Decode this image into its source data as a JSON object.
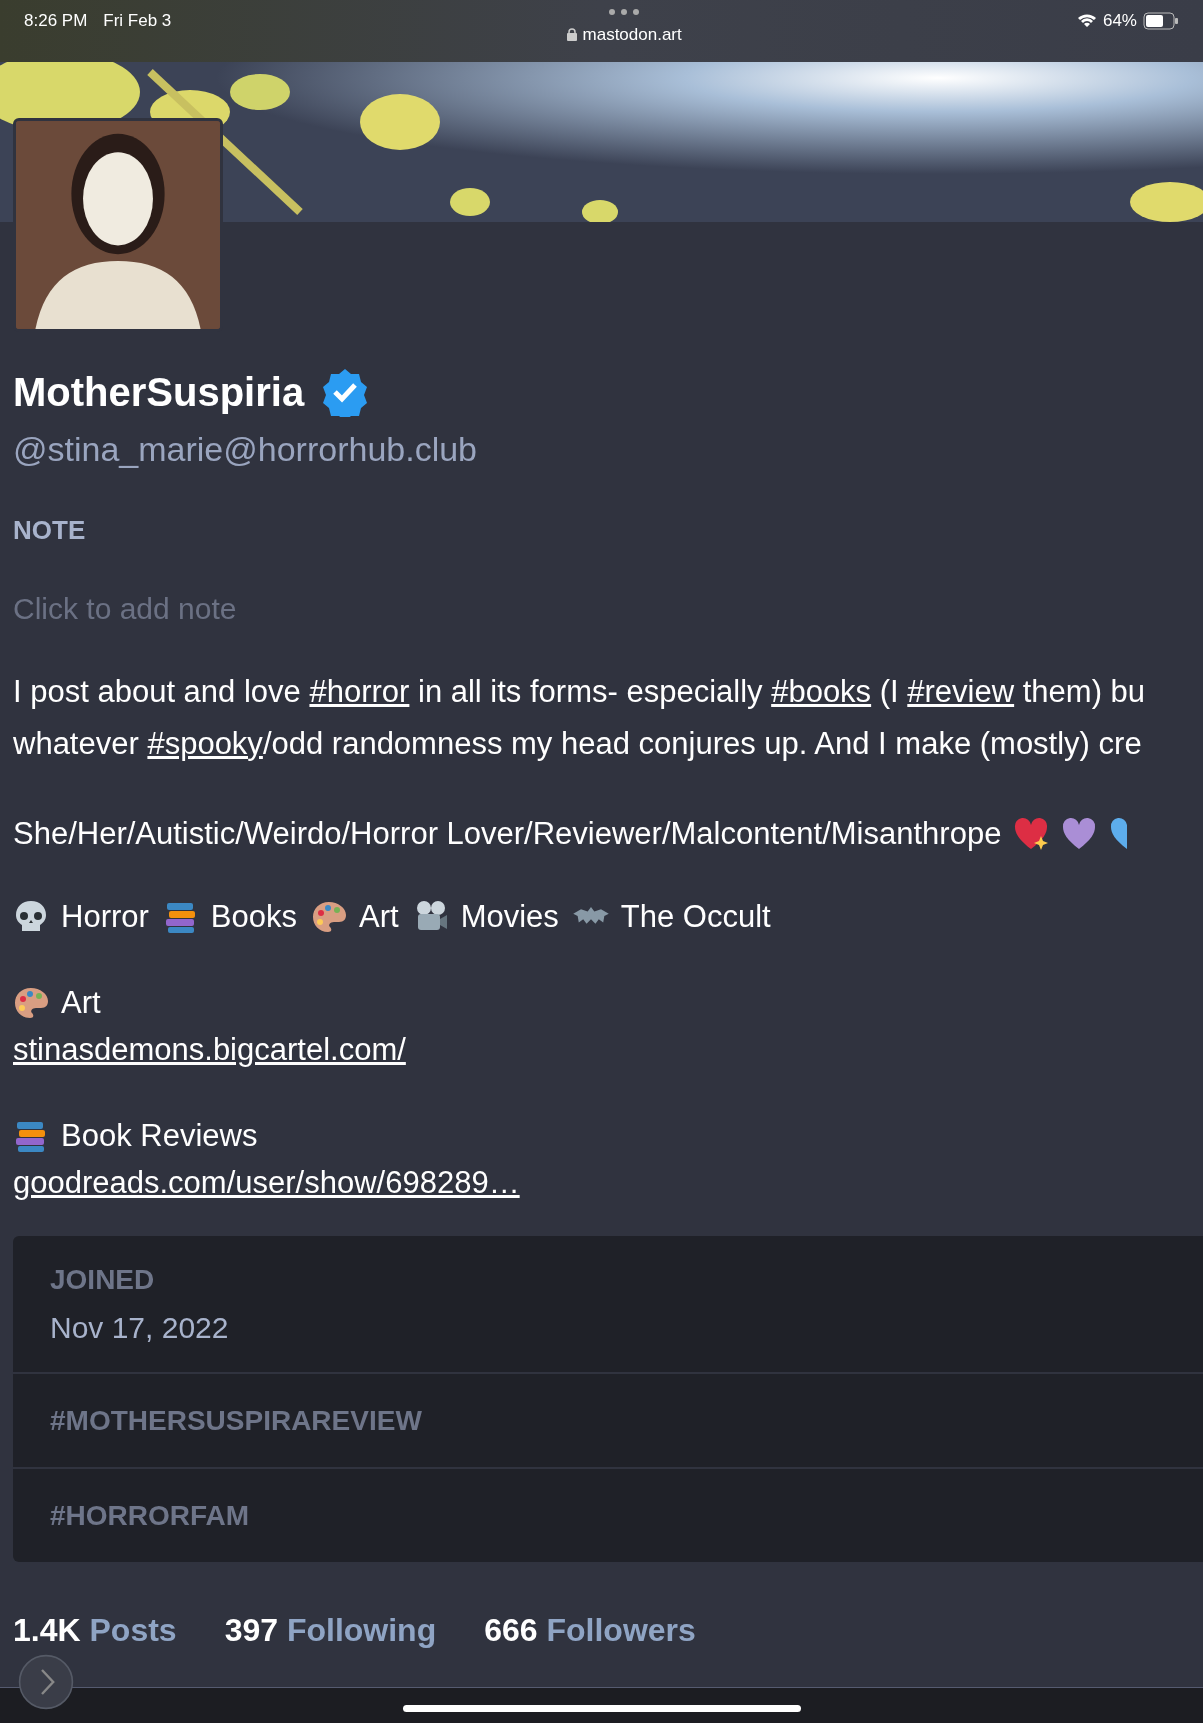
{
  "status_bar": {
    "time": "8:26 PM",
    "date": "Fri Feb 3",
    "url": "mastodon.art",
    "battery": "64%"
  },
  "profile": {
    "display_name": "MotherSuspiria",
    "verified": true,
    "handle": "@stina_marie@horrorhub.club"
  },
  "note": {
    "label": "NOTE",
    "placeholder": "Click to add note"
  },
  "bio_lines": [
    [
      {
        "kind": "text",
        "text": "I post about and love "
      },
      {
        "kind": "link",
        "text": "#horror"
      },
      {
        "kind": "text",
        "text": " in all its forms- especially "
      },
      {
        "kind": "link",
        "text": "#books"
      },
      {
        "kind": "text",
        "text": " (I "
      },
      {
        "kind": "link",
        "text": "#review"
      },
      {
        "kind": "text",
        "text": " them) bu"
      }
    ],
    [
      {
        "kind": "text",
        "text": "whatever "
      },
      {
        "kind": "link",
        "text": "#spooky"
      },
      {
        "kind": "text",
        "text": "/odd randomness my head conjures up. And I make (mostly) cre"
      }
    ]
  ],
  "pronouns": {
    "text": "She/Her/Autistic/Weirdo/Horror Lover/Reviewer/Malcontent/Misanthrope",
    "emojis": [
      {
        "kind": "sparkling-heart"
      },
      {
        "kind": "purple-heart"
      },
      {
        "kind": "blue-heart"
      }
    ]
  },
  "interests": [
    {
      "kind": "skull",
      "label": "Horror"
    },
    {
      "kind": "books",
      "label": "Books"
    },
    {
      "kind": "palette",
      "label": "Art"
    },
    {
      "kind": "projector",
      "label": "Movies"
    },
    {
      "kind": "bat",
      "label": "The Occult"
    }
  ],
  "links": [
    {
      "kind": "palette",
      "label": "Art",
      "url": "stinasdemons.bigcartel.com/"
    },
    {
      "kind": "books",
      "label": "Book Reviews",
      "url": "goodreads.com/user/show/698289…"
    }
  ],
  "fields": [
    {
      "name": "JOINED",
      "value": "Nov 17, 2022"
    },
    {
      "name": "#MOTHERSUSPIRAREVIEW"
    },
    {
      "name": "#HORRORFAM"
    }
  ],
  "stats": [
    {
      "count": "1.4K",
      "label": "Posts"
    },
    {
      "count": "397",
      "label": "Following"
    },
    {
      "count": "666",
      "label": "Followers"
    }
  ]
}
